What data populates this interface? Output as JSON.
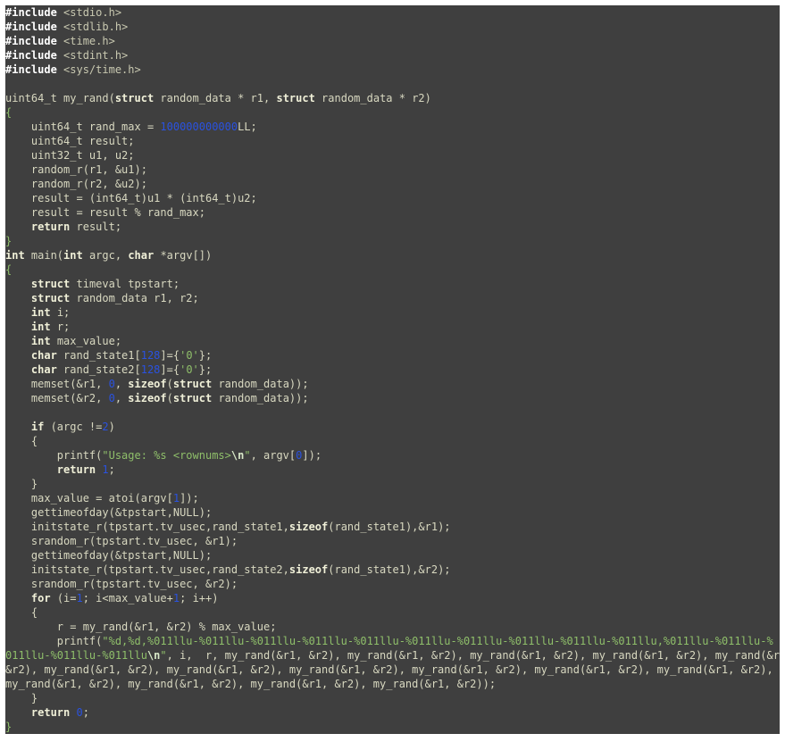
{
  "editor": {
    "colors": {
      "background": "#3f3f3f",
      "text": "#d8d8c0",
      "preprocessor": "#ffffff",
      "keyword": "#f0f0d8",
      "number": "#2a52e0",
      "string": "#8fbf6a"
    },
    "lines": [
      [
        [
          "pre",
          "#include"
        ],
        [
          "hdr",
          " <stdio.h>"
        ]
      ],
      [
        [
          "pre",
          "#include"
        ],
        [
          "hdr",
          " <stdlib.h>"
        ]
      ],
      [
        [
          "pre",
          "#include"
        ],
        [
          "hdr",
          " <time.h>"
        ]
      ],
      [
        [
          "pre",
          "#include"
        ],
        [
          "hdr",
          " <stdint.h>"
        ]
      ],
      [
        [
          "pre",
          "#include"
        ],
        [
          "hdr",
          " <sys/time.h>"
        ]
      ],
      [],
      [
        [
          "txt",
          "uint64_t my_rand("
        ],
        [
          "kw",
          "struct"
        ],
        [
          "txt",
          " random_data * r1, "
        ],
        [
          "kw",
          "struct"
        ],
        [
          "txt",
          " random_data * r2)"
        ]
      ],
      [
        [
          "br",
          "{"
        ]
      ],
      [
        [
          "txt",
          "    uint64_t rand_max = "
        ],
        [
          "num",
          "100000000000"
        ],
        [
          "txt",
          "LL;"
        ]
      ],
      [
        [
          "txt",
          "    uint64_t result;"
        ]
      ],
      [
        [
          "txt",
          "    uint32_t u1, u2;"
        ]
      ],
      [
        [
          "txt",
          "    random_r(r1, &u1);"
        ]
      ],
      [
        [
          "txt",
          "    random_r(r2, &u2);"
        ]
      ],
      [
        [
          "txt",
          "    result = (int64_t)u1 * (int64_t)u2;"
        ]
      ],
      [
        [
          "txt",
          "    result = result % rand_max;"
        ]
      ],
      [
        [
          "txt",
          "    "
        ],
        [
          "kw",
          "return"
        ],
        [
          "txt",
          " result;"
        ]
      ],
      [
        [
          "br",
          "}"
        ]
      ],
      [
        [
          "kw",
          "int"
        ],
        [
          "txt",
          " main("
        ],
        [
          "kw",
          "int"
        ],
        [
          "txt",
          " argc, "
        ],
        [
          "kw",
          "char"
        ],
        [
          "txt",
          " *argv[])"
        ]
      ],
      [
        [
          "br",
          "{"
        ]
      ],
      [
        [
          "txt",
          "    "
        ],
        [
          "kw",
          "struct"
        ],
        [
          "txt",
          " timeval tpstart;"
        ]
      ],
      [
        [
          "txt",
          "    "
        ],
        [
          "kw",
          "struct"
        ],
        [
          "txt",
          " random_data r1, r2;"
        ]
      ],
      [
        [
          "txt",
          "    "
        ],
        [
          "kw",
          "int"
        ],
        [
          "txt",
          " i;"
        ]
      ],
      [
        [
          "txt",
          "    "
        ],
        [
          "kw",
          "int"
        ],
        [
          "txt",
          " r;"
        ]
      ],
      [
        [
          "txt",
          "    "
        ],
        [
          "kw",
          "int"
        ],
        [
          "txt",
          " max_value;"
        ]
      ],
      [
        [
          "txt",
          "    "
        ],
        [
          "kw",
          "char"
        ],
        [
          "txt",
          " rand_state1["
        ],
        [
          "num",
          "128"
        ],
        [
          "txt",
          "]={"
        ],
        [
          "str",
          "'0'"
        ],
        [
          "txt",
          "};"
        ]
      ],
      [
        [
          "txt",
          "    "
        ],
        [
          "kw",
          "char"
        ],
        [
          "txt",
          " rand_state2["
        ],
        [
          "num",
          "128"
        ],
        [
          "txt",
          "]={"
        ],
        [
          "str",
          "'0'"
        ],
        [
          "txt",
          "};"
        ]
      ],
      [
        [
          "txt",
          "    memset(&r1, "
        ],
        [
          "num",
          "0"
        ],
        [
          "txt",
          ", "
        ],
        [
          "kw",
          "sizeof"
        ],
        [
          "txt",
          "("
        ],
        [
          "kw",
          "struct"
        ],
        [
          "txt",
          " random_data));"
        ]
      ],
      [
        [
          "txt",
          "    memset(&r2, "
        ],
        [
          "num",
          "0"
        ],
        [
          "txt",
          ", "
        ],
        [
          "kw",
          "sizeof"
        ],
        [
          "txt",
          "("
        ],
        [
          "kw",
          "struct"
        ],
        [
          "txt",
          " random_data));"
        ]
      ],
      [],
      [
        [
          "txt",
          "    "
        ],
        [
          "kw",
          "if"
        ],
        [
          "txt",
          " (argc !="
        ],
        [
          "num",
          "2"
        ],
        [
          "txt",
          ")"
        ]
      ],
      [
        [
          "txt",
          "    {"
        ]
      ],
      [
        [
          "txt",
          "        printf("
        ],
        [
          "str",
          "\"Usage: %s <rownums>"
        ],
        [
          "esc",
          "\\n"
        ],
        [
          "str",
          "\""
        ],
        [
          "txt",
          ", argv["
        ],
        [
          "num",
          "0"
        ],
        [
          "txt",
          "]);"
        ]
      ],
      [
        [
          "txt",
          "        "
        ],
        [
          "kw",
          "return"
        ],
        [
          "txt",
          " "
        ],
        [
          "num",
          "1"
        ],
        [
          "txt",
          ";"
        ]
      ],
      [
        [
          "txt",
          "    }"
        ]
      ],
      [
        [
          "txt",
          "    max_value = atoi(argv["
        ],
        [
          "num",
          "1"
        ],
        [
          "txt",
          "]);"
        ]
      ],
      [
        [
          "txt",
          "    gettimeofday(&tpstart,NULL);"
        ]
      ],
      [
        [
          "txt",
          "    initstate_r(tpstart.tv_usec,rand_state1,"
        ],
        [
          "kw",
          "sizeof"
        ],
        [
          "txt",
          "(rand_state1),&r1);"
        ]
      ],
      [
        [
          "txt",
          "    srandom_r(tpstart.tv_usec, &r1);"
        ]
      ],
      [
        [
          "txt",
          "    gettimeofday(&tpstart,NULL);"
        ]
      ],
      [
        [
          "txt",
          "    initstate_r(tpstart.tv_usec,rand_state2,"
        ],
        [
          "kw",
          "sizeof"
        ],
        [
          "txt",
          "(rand_state1),&r2);"
        ]
      ],
      [
        [
          "txt",
          "    srandom_r(tpstart.tv_usec, &r2);"
        ]
      ],
      [
        [
          "txt",
          "    "
        ],
        [
          "kw",
          "for"
        ],
        [
          "txt",
          " (i="
        ],
        [
          "num",
          "1"
        ],
        [
          "txt",
          "; i<max_value+"
        ],
        [
          "num",
          "1"
        ],
        [
          "txt",
          "; i++)"
        ]
      ],
      [
        [
          "txt",
          "    {"
        ]
      ],
      [
        [
          "txt",
          "        r = my_rand(&r1, &r2) % max_value;"
        ]
      ],
      [
        [
          "txt",
          "        printf("
        ],
        [
          "str",
          "\"%d,%d,%011llu-%011llu-%011llu-%011llu-%011llu-%011llu-%011llu-%011llu-%011llu-%011llu,%011llu-%011llu-%"
        ]
      ],
      [
        [
          "str",
          "011llu-%011llu-%011llu"
        ],
        [
          "esc",
          "\\n"
        ],
        [
          "str",
          "\""
        ],
        [
          "txt",
          ", i,  r, my_rand(&r1, &r2), my_rand(&r1, &r2), my_rand(&r1, &r2), my_rand(&r1, &r2), my_rand(&r1,"
        ]
      ],
      [
        [
          "txt",
          "&r2), my_rand(&r1, &r2), my_rand(&r1, &r2), my_rand(&r1, &r2), my_rand(&r1, &r2), my_rand(&r1, &r2), my_rand(&r1, &r2),"
        ]
      ],
      [
        [
          "txt",
          "my_rand(&r1, &r2), my_rand(&r1, &r2), my_rand(&r1, &r2), my_rand(&r1, &r2));"
        ]
      ],
      [
        [
          "txt",
          "    }"
        ]
      ],
      [
        [
          "txt",
          "    "
        ],
        [
          "kw",
          "return"
        ],
        [
          "txt",
          " "
        ],
        [
          "num",
          "0"
        ],
        [
          "txt",
          ";"
        ]
      ],
      [
        [
          "br",
          "}"
        ]
      ]
    ]
  }
}
